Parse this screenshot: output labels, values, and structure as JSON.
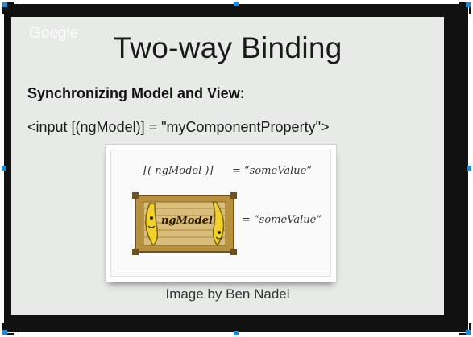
{
  "slide": {
    "watermark": "Google",
    "title": "Two-way Binding",
    "subtitle": "Synchronizing Model and View:",
    "code": "<input [(ngModel)] = \"myComponentProperty\">",
    "caption": "Image by Ben Nadel"
  },
  "diagram": {
    "syntax_label": "[( ngModel )]",
    "value_label_1": "= “someValue”",
    "box_label": "ngModel",
    "value_label_2": "= “someValue”"
  },
  "colors": {
    "slide_bg": "#e7eae7",
    "frame": "#111111",
    "handle": "#1e8ad6",
    "banana": "#f2d22a",
    "box_wood": "#b8913f"
  }
}
